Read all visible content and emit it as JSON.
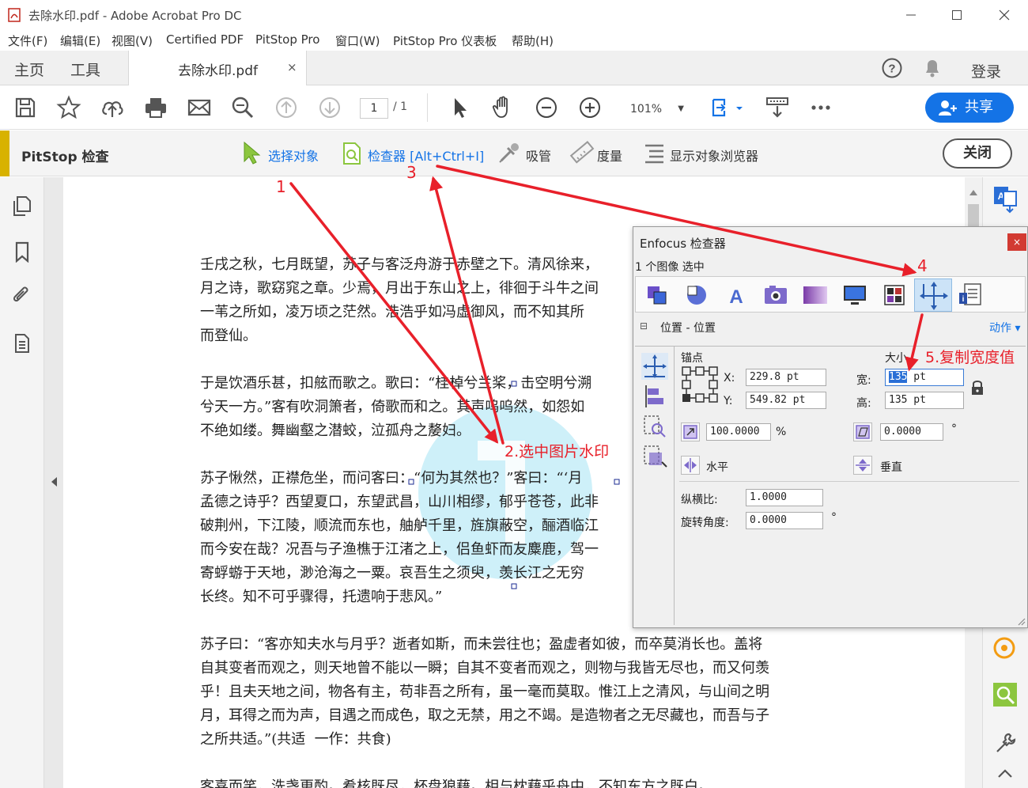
{
  "window": {
    "title": "去除水印.pdf - Adobe Acrobat Pro DC"
  },
  "menu": [
    "文件(F)",
    "编辑(E)",
    "视图(V)",
    "Certified PDF",
    "PitStop Pro",
    "窗口(W)",
    "PitStop Pro 仪表板",
    "帮助(H)"
  ],
  "tabs": {
    "home": "主页",
    "tools": "工具",
    "document": "去除水印.pdf",
    "close": "×",
    "login": "登录"
  },
  "toolbar": {
    "page_current": "1",
    "page_total": "/ 1",
    "zoom": "101%",
    "share": "共享"
  },
  "pitstop": {
    "title": "PitStop 检查",
    "select_object": "选择对象",
    "inspector": "检查器 [Alt+Ctrl+I]",
    "eyedropper": "吸管",
    "measure": "度量",
    "object_browser": "显示对象浏览器",
    "close": "关闭"
  },
  "document": {
    "paragraphs": [
      [
        "壬戌之秋，七月既望，苏子与客泛舟游于赤壁之下。清风徐来，",
        "月之诗，歌窈窕之章。少焉，月出于东山之上，徘徊于斗牛之间",
        "一苇之所如，凌万顷之茫然。浩浩乎如冯虚御风，而不知其所",
        "而登仙。"
      ],
      [
        "于是饮酒乐甚，扣舷而歌之。歌曰：“桂棹兮兰桨，击空明兮溯",
        "兮天一方。”客有吹洞箫者，倚歌而和之。其声呜呜然，如怨如",
        "不绝如缕。舞幽壑之潜蛟，泣孤舟之嫠妇。"
      ],
      [
        "苏子愀然，正襟危坐，而问客曰：“何为其然也？”客曰：“‘月",
        "孟德之诗乎？西望夏口，东望武昌，山川相缪，郁乎苍苍，此非",
        "破荆州，下江陵，顺流而东也，舳舻千里，旌旗蔽空，酾酒临江",
        "而今安在哉？况吾与子渔樵于江渚之上，侣鱼虾而友麋鹿，驾一",
        "寄蜉蝣于天地，渺沧海之一粟。哀吾生之须臾，羡长江之无穷",
        "长终。知不可乎骤得，托遗响于悲风。”"
      ],
      [
        "苏子曰：“客亦知夫水与月乎？逝者如斯，而未尝往也；盈虚者如彼，而卒莫消长也。盖将",
        "自其变者而观之，则天地曾不能以一瞬；自其不变者而观之，则物与我皆无尽也，而又何羡",
        "乎！且夫天地之间，物各有主，苟非吾之所有，虽一毫而莫取。惟江上之清风，与山间之明",
        "月，耳得之而为声，目遇之而成色，取之无禁，用之不竭。是造物者之无尽藏也，而吾与子",
        "之所共适。”(共适  一作：共食)"
      ],
      [
        "客喜而笑，洗盏更酌。肴核既尽，杯盘狼藉。相与枕藉乎舟中，不知东方之既白。"
      ]
    ]
  },
  "inspector": {
    "title": "Enfocus 检查器",
    "close": "×",
    "selection": "1 个图像 选中",
    "section_toggle": "⊟",
    "section_label": "位置 - 位置",
    "action": "动作 ▾",
    "anchor_label": "锚点",
    "size_label": "大小",
    "x_label": "X:",
    "x_value": "229.8 pt",
    "y_label": "Y:",
    "y_value": "549.82 pt",
    "width_label": "宽:",
    "width_number": "135",
    "width_unit": " pt",
    "height_label": "高:",
    "height_value": "135 pt",
    "scale_value": "100.0000",
    "scale_unit": "%",
    "skew_value": "0.0000",
    "skew_unit": "°",
    "horizontal": "水平",
    "vertical": "垂直",
    "aspect_label": "纵横比:",
    "aspect_value": "1.0000",
    "rotation_label": "旋转角度:",
    "rotation_value": "0.0000",
    "rotation_unit": "°"
  },
  "annotations": {
    "step1": "1",
    "step2": "2.选中图片水印",
    "step3": "3",
    "step4": "4",
    "step5": "5.复制宽度值"
  },
  "colors": {
    "accent_blue": "#1473e6",
    "pitstop_yellow": "#d8b200",
    "annotation_red": "#e8202a",
    "watermark_cyan": "#7fd7f0"
  },
  "icons": {
    "save": "save-icon",
    "bookmark": "star-icon",
    "upload": "cloud-upload-icon",
    "print": "printer-icon",
    "mail": "mail-icon",
    "search": "zoom-search-icon"
  }
}
